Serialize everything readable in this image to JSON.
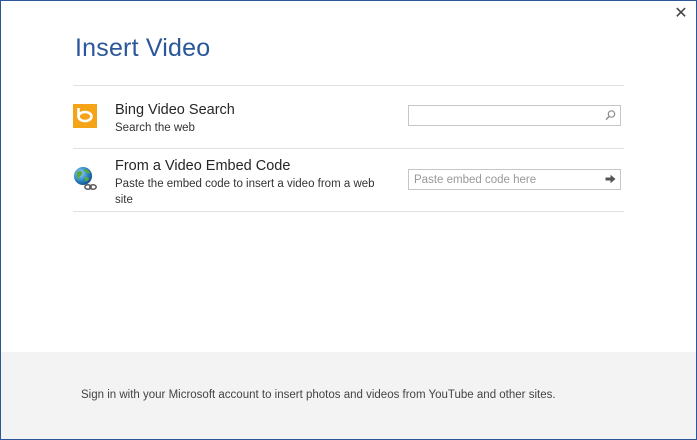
{
  "dialog": {
    "title": "Insert Video",
    "close_label": "✕"
  },
  "rows": [
    {
      "title": "Bing Video Search",
      "description": "Search the web",
      "field_value": "",
      "field_placeholder": "",
      "button_icon": "search-icon"
    },
    {
      "title": "From a Video Embed Code",
      "description": "Paste the embed code to insert a video from a web site",
      "field_value": "",
      "field_placeholder": "Paste embed code here",
      "button_icon": "arrow-right-icon"
    }
  ],
  "footer": {
    "text": "Sign in with your Microsoft account to insert photos and videos from YouTube and other sites."
  },
  "colors": {
    "accent": "#2b579a",
    "bing_orange": "#f4a416",
    "footer_bg": "#f3f3f3",
    "separator": "#e1e1e1"
  }
}
